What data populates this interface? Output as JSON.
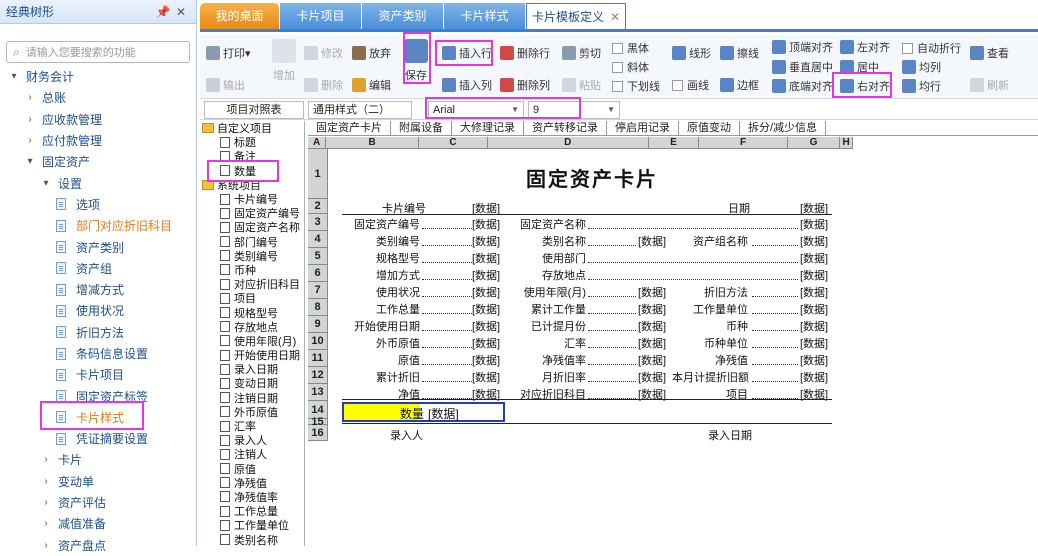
{
  "left_panel": {
    "title": "经典树形",
    "pin_icon": "pin-icon",
    "close_icon": "close-icon",
    "search_placeholder": "请输入您要搜索的功能",
    "tree": [
      {
        "label": "财务会计",
        "level": 0,
        "arrow": "▾"
      },
      {
        "label": "总账",
        "level": 1,
        "arrow": "›"
      },
      {
        "label": "应收款管理",
        "level": 1,
        "arrow": "›"
      },
      {
        "label": "应付款管理",
        "level": 1,
        "arrow": "›"
      },
      {
        "label": "固定资产",
        "level": 1,
        "arrow": "▾"
      },
      {
        "label": "设置",
        "level": 2,
        "arrow": "▾"
      },
      {
        "label": "选项",
        "level": 3,
        "doc": true
      },
      {
        "label": "部门对应折旧科目",
        "level": 3,
        "doc": true,
        "orange": true
      },
      {
        "label": "资产类别",
        "level": 3,
        "doc": true
      },
      {
        "label": "资产组",
        "level": 3,
        "doc": true
      },
      {
        "label": "增减方式",
        "level": 3,
        "doc": true
      },
      {
        "label": "使用状况",
        "level": 3,
        "doc": true
      },
      {
        "label": "折旧方法",
        "level": 3,
        "doc": true
      },
      {
        "label": "条码信息设置",
        "level": 3,
        "doc": true
      },
      {
        "label": "卡片项目",
        "level": 3,
        "doc": true
      },
      {
        "label": "固定资产标签",
        "level": 3,
        "doc": true
      },
      {
        "label": "卡片样式",
        "level": 3,
        "doc": true,
        "orange": true
      },
      {
        "label": "凭证摘要设置",
        "level": 3,
        "doc": true
      },
      {
        "label": "卡片",
        "level": 2,
        "arrow": "›"
      },
      {
        "label": "变动单",
        "level": 2,
        "arrow": "›"
      },
      {
        "label": "资产评估",
        "level": 2,
        "arrow": "›"
      },
      {
        "label": "减值准备",
        "level": 2,
        "arrow": "›"
      },
      {
        "label": "资产盘点",
        "level": 2,
        "arrow": "›"
      }
    ]
  },
  "tabs": [
    {
      "label": "我的桌面",
      "kind": "home"
    },
    {
      "label": "卡片项目"
    },
    {
      "label": "资产类别"
    },
    {
      "label": "卡片样式"
    },
    {
      "label": "卡片模板定义",
      "kind": "active"
    }
  ],
  "toolbar": {
    "print": "打印",
    "export": "输出",
    "add": "增加",
    "edit": "修改",
    "delete": "删除",
    "discard": "放弃",
    "edit2": "编辑",
    "save": "保存",
    "insert_row": "插入行",
    "insert_col": "插入列",
    "delete_row": "删除行",
    "delete_col": "删除列",
    "cut": "剪切",
    "paste": "粘贴",
    "bold": "黑体",
    "italic": "斜体",
    "underline": "下划线",
    "line_style": "线形",
    "draw_line": "画线",
    "eraser": "擦线",
    "border": "边框",
    "top_align": "顶端对齐",
    "vcenter": "垂直居中",
    "bottom_align": "底端对齐",
    "left_align": "左对齐",
    "center": "居中",
    "right_align": "右对齐",
    "wrap": "自动折行",
    "even_col": "均列",
    "even_row": "均行",
    "view": "查看",
    "refresh": "刷新"
  },
  "format_bar": {
    "item_lookup": "项目对照表",
    "style": "通用样式（二）",
    "font": "Arial",
    "size": "9"
  },
  "field_tree": {
    "groups": [
      {
        "label": "自定义项目",
        "items": [
          "标题",
          "备注",
          "数量"
        ]
      },
      {
        "label": "系统项目",
        "items": [
          "卡片编号",
          "固定资产编号",
          "固定资产名称",
          "部门编号",
          "类别编号",
          "币种",
          "对应折旧科目",
          "项目",
          "规格型号",
          "存放地点",
          "使用年限(月)",
          "开始使用日期",
          "录入日期",
          "变动日期",
          "注销日期",
          "外币原值",
          "汇率",
          "录入人",
          "注销人",
          "原值",
          "净残值",
          "净残值率",
          "工作总量",
          "工作量单位",
          "类别名称"
        ]
      }
    ]
  },
  "sheet_tabs": [
    "固定资产卡片",
    "附属设备",
    "大修理记录",
    "资产转移记录",
    "停启用记录",
    "原值变动",
    "拆分/减少信息"
  ],
  "columns": [
    "A",
    "B",
    "C",
    "D",
    "E",
    "F",
    "G",
    "H"
  ],
  "rows": [
    "1",
    "2",
    "3",
    "4",
    "5",
    "6",
    "7",
    "8",
    "9",
    "10",
    "11",
    "12",
    "13",
    "14",
    "15",
    "16"
  ],
  "card": {
    "title": "固定资产卡片",
    "data_tag": "[数据]",
    "row2": {
      "card_no": "卡片编号",
      "date": "日期"
    },
    "left_labels": [
      "固定资产编号",
      "类别编号",
      "规格型号",
      "增加方式",
      "使用状况",
      "工作总量",
      "开始使用日期",
      "外币原值",
      "原值",
      "累计折旧",
      "净值"
    ],
    "mid_labels": [
      "固定资产名称",
      "类别名称",
      "使用部门",
      "存放地点",
      "使用年限(月)",
      "累计工作量",
      "已计提月份",
      "汇率",
      "净残值率",
      "月折旧率",
      "对应折旧科目"
    ],
    "right_labels": [
      "",
      "资产组名称",
      "",
      "",
      "折旧方法",
      "工作量单位",
      "币种",
      "币种单位",
      "净残值",
      "本月计提折旧额",
      "项目"
    ],
    "row14_label": "数量",
    "row14_data": "[数据]",
    "row16": {
      "entry_person": "录入人",
      "entry_date": "录入日期"
    }
  },
  "colors": {
    "accent": "#3a7fd2",
    "highlight": "#e633e6",
    "home_tab": "#f0a030",
    "selection": "#ffff00",
    "selection_border": "#1f3fbf"
  }
}
